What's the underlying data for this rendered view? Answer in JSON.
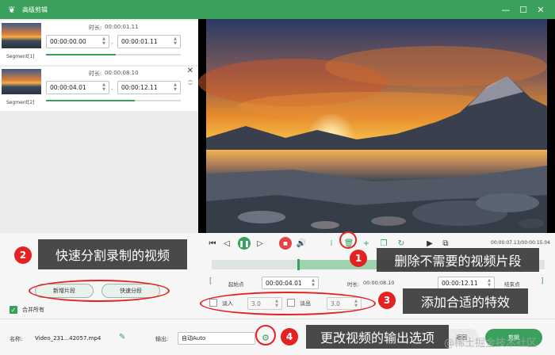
{
  "titlebar": {
    "title": "高级剪辑"
  },
  "segments": [
    {
      "name": "Segment[1]",
      "duration_label": "时长:",
      "duration": "00:00:01.11",
      "start": "00:00:00.00",
      "end": "00:00:01.11",
      "progress_start": 0.0,
      "progress_end": 0.52
    },
    {
      "name": "Segment[2]",
      "duration_label": "时长:",
      "duration": "00:00:08.10",
      "start": "00:00:04.01",
      "end": "00:00:12.11",
      "progress_start": 0.0,
      "progress_end": 0.66
    }
  ],
  "controls": {
    "time_readout": "00:00:07.13/00:00:15.04",
    "timeline_selection_start": 0.26,
    "timeline_selection_end": 0.82
  },
  "range": {
    "start_label": "起始点",
    "start_value": "00:00:04.01",
    "duration_label": "时长:",
    "duration_value": "00:00:08.10",
    "end_value": "00:00:12.11",
    "end_label": "结束点"
  },
  "fade": {
    "fade_in_label": "淡入",
    "fade_in_value": "3.0",
    "fade_out_label": "淡出",
    "fade_out_value": "3.0"
  },
  "buttons": {
    "new_segment": "新增片段",
    "quick_split": "快速分段",
    "merge_all": "合并所有",
    "cancel": "返回",
    "export": "剪辑"
  },
  "bottom": {
    "name_label": "名称:",
    "file_name": "Video_231...42057.mp4",
    "output_label": "输出:",
    "output_value": "自动Auto"
  },
  "callouts": [
    {
      "number": "1",
      "text": "删除不需要的视频片段"
    },
    {
      "number": "2",
      "text": "快速分割录制的视频"
    },
    {
      "number": "3",
      "text": "添加合适的特效"
    },
    {
      "number": "4",
      "text": "更改视频的输出选项"
    }
  ],
  "watermark": "@稀土掘金技术社区",
  "colors": {
    "accent": "#3aa05b",
    "callout_red": "#e32222",
    "callout_bg": "#3a3a3a"
  }
}
